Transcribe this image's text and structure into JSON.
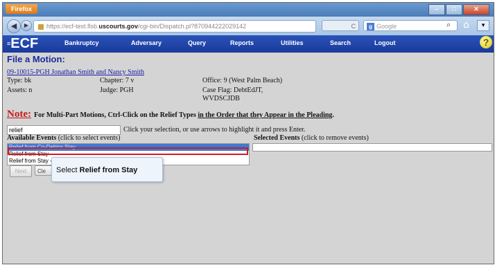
{
  "browser": {
    "app_button": "Firefox",
    "url_prefix": "https://ecf-test.flsb.",
    "url_domain": "uscourts.gov",
    "url_path": "/cgi-bin/Dispatch.pl?870944222029142",
    "search_placeholder": "Google"
  },
  "menu": {
    "logo": "ECF",
    "items": [
      "Bankruptcy",
      "Adversary",
      "Query",
      "Reports",
      "Utilities",
      "Search",
      "Logout"
    ]
  },
  "page": {
    "title": "File a Motion:",
    "case_link": "09-10015-PGH Jonathan Smith and Nancy Smith",
    "type": "Type: bk",
    "chapter": "Chapter: 7 v",
    "office": "Office: 9 (West Palm Beach)",
    "assets": "Assets: n",
    "judge": "Judge: PGH",
    "case_flag_line1": "Case Flag: DebtEdJT,",
    "case_flag_line2": "WVDSCJDB",
    "note_label": "Note:",
    "note_text": "For Multi-Part Motions, Ctrl-Click on the Relief Types ",
    "note_underlined": "in the Order that they Appear in the Pleading",
    "note_end": ".",
    "filter_value": "relief",
    "filter_hint": "Click your selection, or use arrows to highlight it and press Enter.",
    "available_label": "Available Events",
    "available_hint": "(click to select events)",
    "selected_label": "Selected Events",
    "selected_hint": "(click to remove events)",
    "options": [
      "Relief from Co-Debtor Stay",
      "Relief from Stay",
      "Relief from Stay - ..."
    ],
    "next_button": "Next",
    "clear_button": "Cle"
  },
  "callout": {
    "prefix": "Select ",
    "bold": "Relief from Stay"
  }
}
